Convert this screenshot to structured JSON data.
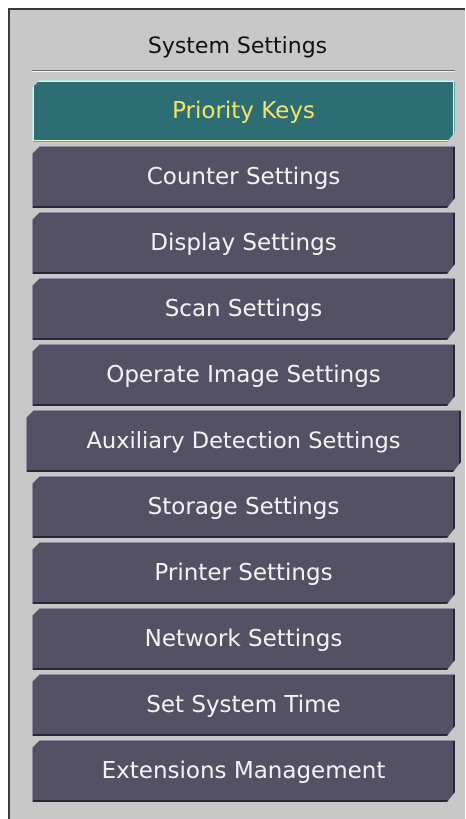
{
  "panel": {
    "title": "System Settings"
  },
  "menu": {
    "items": [
      {
        "label": "Priority Keys",
        "active": true
      },
      {
        "label": "Counter Settings",
        "active": false
      },
      {
        "label": "Display Settings",
        "active": false
      },
      {
        "label": "Scan Settings",
        "active": false
      },
      {
        "label": "Operate Image Settings",
        "active": false
      },
      {
        "label": "Auxiliary Detection Settings",
        "active": false
      },
      {
        "label": "Storage Settings",
        "active": false
      },
      {
        "label": "Printer Settings",
        "active": false
      },
      {
        "label": "Network Settings",
        "active": false
      },
      {
        "label": "Set System Time",
        "active": false
      },
      {
        "label": "Extensions Management",
        "active": false
      }
    ]
  },
  "colors": {
    "panel_background": "#c8c8c8",
    "button_background": "#555165",
    "button_text": "#f2f2f2",
    "active_background": "#2d6d74",
    "active_text": "#f0e36a"
  }
}
